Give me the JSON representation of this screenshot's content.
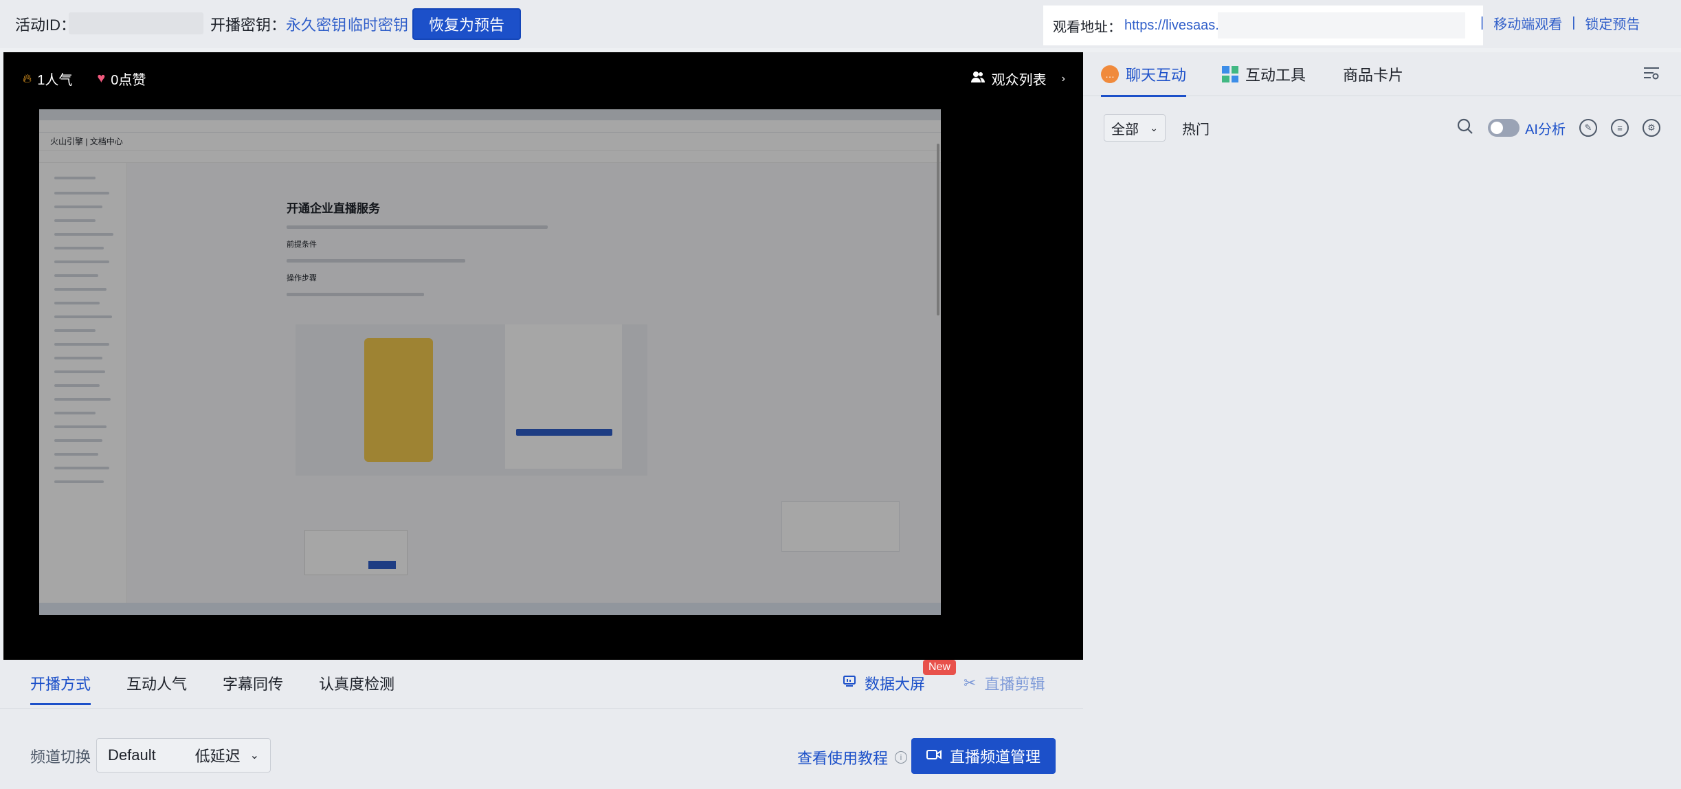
{
  "topbar": {
    "activity_id_label": "活动ID：",
    "key_label": "开播密钥：",
    "permanent_key": "永久密钥",
    "temporary_key": "临时密钥",
    "restore_button": "恢复为预告",
    "watch_label": "观看地址：",
    "watch_url": "https://livesaas.",
    "mobile_watch": "移动端观看",
    "lock_preview": "锁定预告"
  },
  "video": {
    "popularity": "1人气",
    "likes": "0点赞",
    "audience_list": "观众列表"
  },
  "shared_screen": {
    "brand": "火山引擎 | 文档中心",
    "doc_title": "开通企业直播服务",
    "section_prereq": "前提条件",
    "section_steps": "操作步骤"
  },
  "right_panel": {
    "tabs": [
      {
        "label": "聊天互动"
      },
      {
        "label": "互动工具"
      },
      {
        "label": "商品卡片"
      }
    ],
    "filter_all": "全部",
    "filter_hot": "热门",
    "ai_label": "AI分析"
  },
  "bottom_panel": {
    "tabs": [
      {
        "label": "开播方式"
      },
      {
        "label": "互动人气"
      },
      {
        "label": "字幕同传"
      },
      {
        "label": "认真度检测"
      }
    ],
    "data_screen": "数据大屏",
    "new_badge": "New",
    "live_clip": "直播剪辑",
    "channel_label": "频道切换",
    "channel_value": "Default",
    "latency_value": "低延迟",
    "tutorial_link": "查看使用教程",
    "channel_manage_button": "直播频道管理"
  },
  "colors": {
    "accent": "#1c50c9",
    "badge": "#e8514b",
    "background": "#e9ebef"
  }
}
